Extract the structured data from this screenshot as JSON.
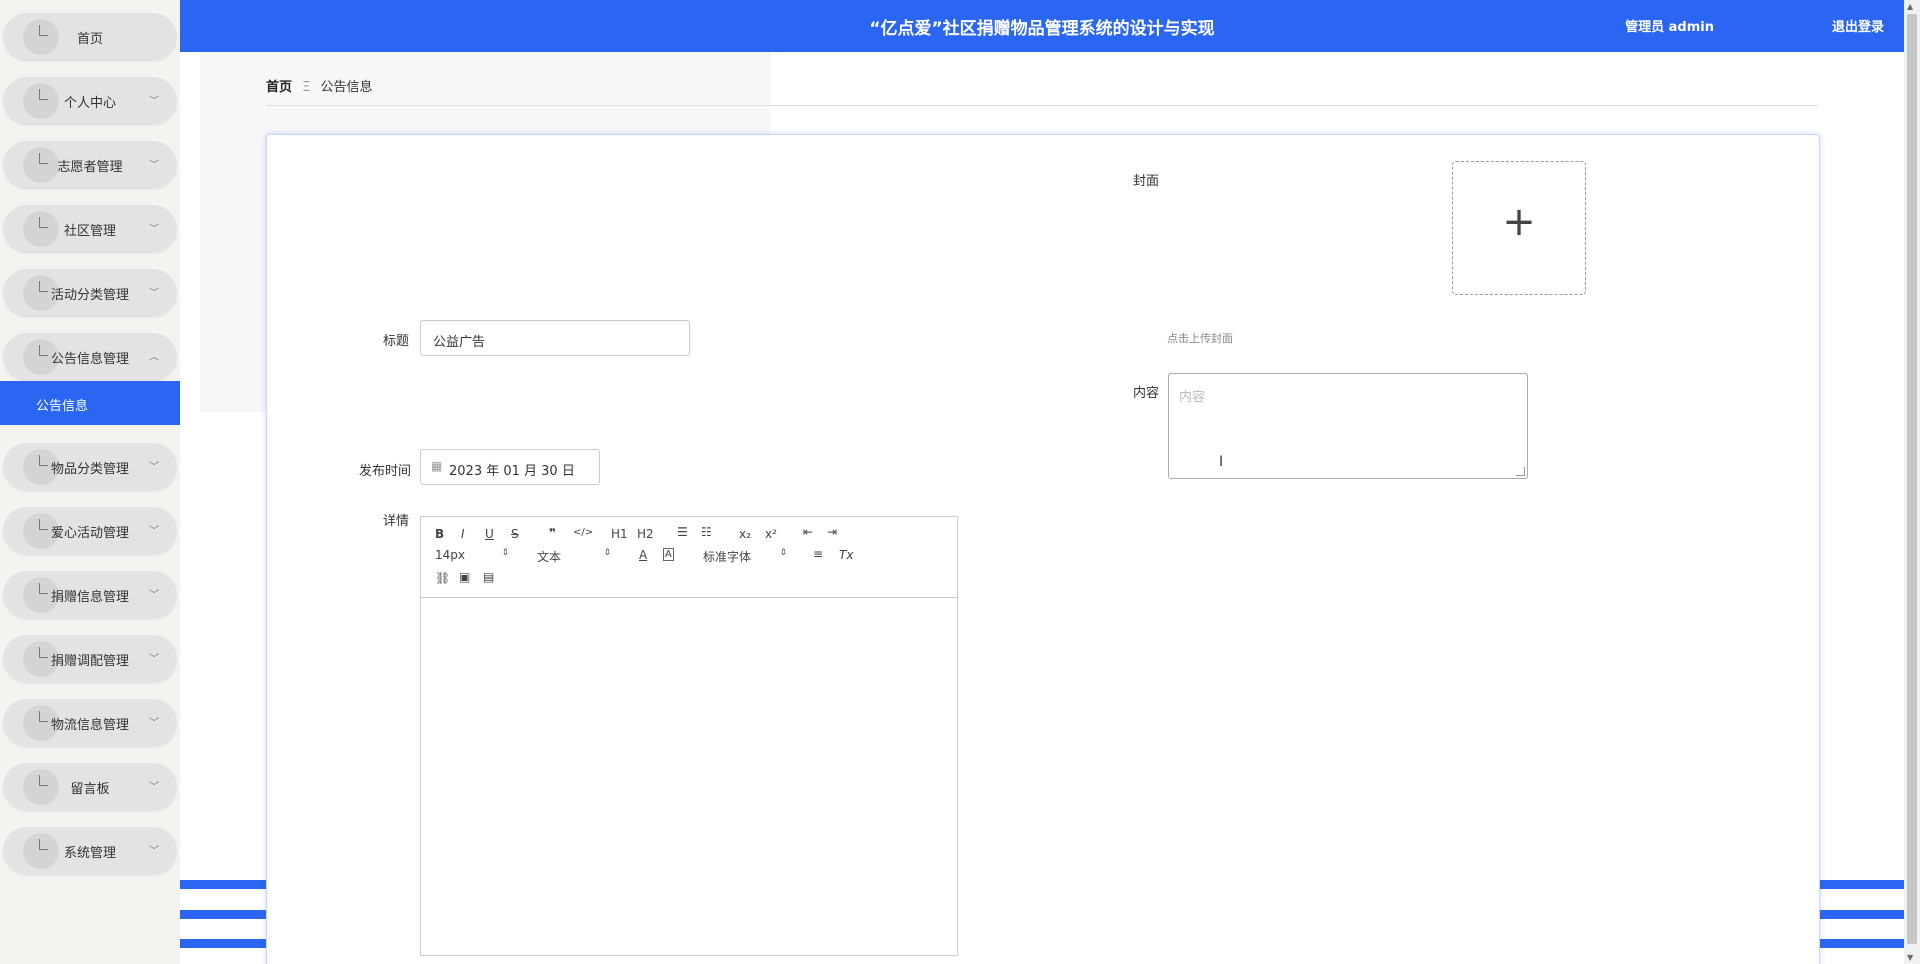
{
  "header": {
    "title": "“亿点爱”社区捐赠物品管理系统的设计与实现",
    "user": "管理员 admin",
    "logout": "退出登录"
  },
  "sidebar": {
    "items": [
      {
        "label": "首页",
        "has_chevron": false
      },
      {
        "label": "个人中心",
        "has_chevron": true
      },
      {
        "label": "志愿者管理",
        "has_chevron": true
      },
      {
        "label": "社区管理",
        "has_chevron": true
      },
      {
        "label": "活动分类管理",
        "has_chevron": true
      },
      {
        "label": "公告信息管理",
        "has_chevron": true,
        "expanded": true
      },
      {
        "label": "物品分类管理",
        "has_chevron": true
      },
      {
        "label": "爱心活动管理",
        "has_chevron": true
      },
      {
        "label": "捐赠信息管理",
        "has_chevron": true
      },
      {
        "label": "捐赠调配管理",
        "has_chevron": true
      },
      {
        "label": "物流信息管理",
        "has_chevron": true
      },
      {
        "label": "留言板",
        "has_chevron": true
      },
      {
        "label": "系统管理",
        "has_chevron": true
      }
    ],
    "active_subitem": "公告信息"
  },
  "breadcrumb": {
    "home": "首页",
    "separator": "Ξ",
    "current": "公告信息"
  },
  "form": {
    "title_label": "标题",
    "title_value": "公益广告",
    "cover_label": "封面",
    "cover_upload_hint": "点击上传封面",
    "content_label": "内容",
    "content_placeholder": "内容",
    "publish_time_label": "发布时间",
    "publish_time_value": "2023 年 01 月 30 日",
    "detail_label": "详情"
  },
  "editor": {
    "font_size": "14px",
    "header_select": "文本",
    "font_family": "标准字体",
    "buttons": {
      "bold": "B",
      "italic": "I",
      "underline": "U",
      "strike": "S",
      "blockquote": "❞",
      "code": "</>",
      "h1": "H1",
      "h2": "H2",
      "subscript": "x₂",
      "superscript": "x²",
      "clean": "Tx"
    }
  },
  "colors": {
    "primary": "#2a66f1",
    "sidebar_bg": "#f3f3ef",
    "menu_pill": "#e3e3e3"
  }
}
